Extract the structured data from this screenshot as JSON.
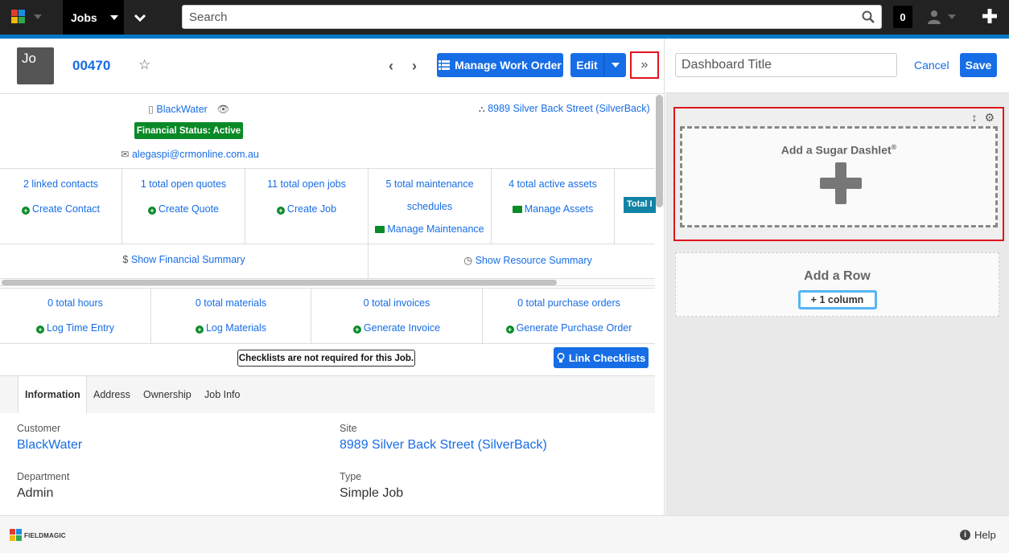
{
  "topbar": {
    "module": "Jobs",
    "search_placeholder": "Search",
    "notifications": "0"
  },
  "record": {
    "avatar": "Jo",
    "name": "00470",
    "manage_work_order": "Manage Work Order",
    "edit": "Edit",
    "toggle": "»",
    "account": "BlackWater",
    "site": "8989 Silver Back Street (SilverBack)",
    "financial_status": "Financial Status: Active",
    "email": "alegaspi@crmonline.com.au"
  },
  "stats_row1": [
    {
      "count": "2 linked contacts",
      "action": "Create Contact"
    },
    {
      "count": "1 total open quotes",
      "action": "Create Quote"
    },
    {
      "count": "11 total open jobs",
      "action": "Create Job"
    },
    {
      "count_a": "5 total maintenance",
      "count_b": "schedules",
      "action": "Manage Maintenance"
    },
    {
      "count": "4 total active assets",
      "action": "Manage Assets"
    }
  ],
  "total_badge": "Total I",
  "summaries": {
    "financial": "Show Financial Summary",
    "resource": "Show Resource Summary"
  },
  "stats_row2": [
    {
      "count": "0 total hours",
      "action": "Log Time Entry"
    },
    {
      "count": "0 total materials",
      "action": "Log Materials"
    },
    {
      "count": "0 total invoices",
      "action": "Generate Invoice"
    },
    {
      "count": "0 total purchase orders",
      "action": "Generate Purchase Order"
    }
  ],
  "checklists": {
    "note": "Checklists are not required for this Job.",
    "link_button": "Link Checklists"
  },
  "tabs": [
    "Information",
    "Address",
    "Ownership",
    "Job Info"
  ],
  "fields": {
    "customer_label": "Customer",
    "customer_value": "BlackWater",
    "site_label": "Site",
    "site_value": "8989 Silver Back Street (SilverBack)",
    "department_label": "Department",
    "department_value": "Admin",
    "type_label": "Type",
    "type_value": "Simple Job"
  },
  "dashboard": {
    "title_placeholder": "Dashboard Title",
    "cancel": "Cancel",
    "save": "Save",
    "add_dashlet": "Add a Sugar Dashlet",
    "registered": "®",
    "add_row": "Add a Row",
    "one_column": "+ 1 column"
  },
  "footer": {
    "brand": "FIELDMAGIC",
    "help": "Help"
  },
  "colors": {
    "primary": "#176de5",
    "success": "#098a27",
    "highlight": "#e0141b",
    "topbar": "#222222"
  }
}
